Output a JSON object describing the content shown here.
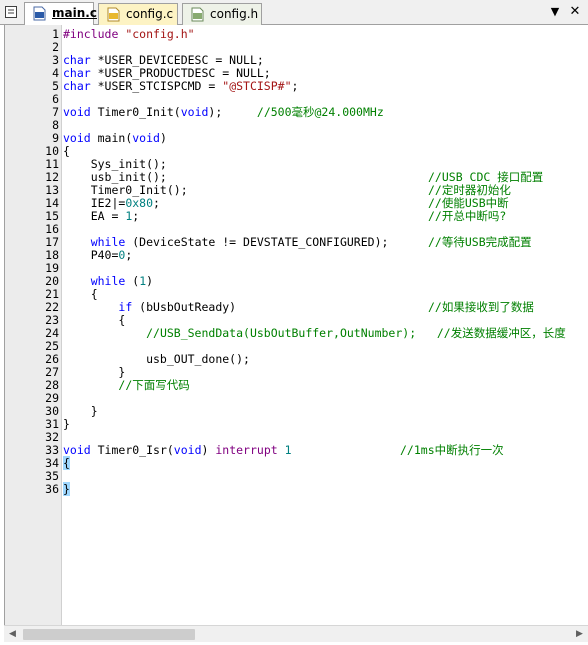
{
  "tabs": [
    {
      "label": "main.c",
      "active": true
    },
    {
      "label": "config.c",
      "active": false
    },
    {
      "label": "config.h",
      "active": false
    }
  ],
  "icons": {
    "tab_list": "document-list-icon",
    "file": "c-file-icon",
    "dropdown": "chevron-down-icon",
    "close": "close-icon",
    "scroll_left": "arrow-left-icon",
    "scroll_right": "arrow-right-icon"
  },
  "colors": {
    "keyword": "#0000ff",
    "comment": "#008000",
    "string": "#a31515",
    "number": "#008080",
    "gutter": "#ececec",
    "tab_config_c": "#fdf3c4"
  },
  "lines": [
    {
      "n": "1"
    },
    {
      "n": "2"
    },
    {
      "n": "3"
    },
    {
      "n": "4"
    },
    {
      "n": "5"
    },
    {
      "n": "6"
    },
    {
      "n": "7"
    },
    {
      "n": "8"
    },
    {
      "n": "9"
    },
    {
      "n": "10"
    },
    {
      "n": "11"
    },
    {
      "n": "12"
    },
    {
      "n": "13"
    },
    {
      "n": "14"
    },
    {
      "n": "15"
    },
    {
      "n": "16"
    },
    {
      "n": "17"
    },
    {
      "n": "18"
    },
    {
      "n": "19"
    },
    {
      "n": "20"
    },
    {
      "n": "21"
    },
    {
      "n": "22"
    },
    {
      "n": "23"
    },
    {
      "n": "24"
    },
    {
      "n": "25"
    },
    {
      "n": "26"
    },
    {
      "n": "27"
    },
    {
      "n": "28"
    },
    {
      "n": "29"
    },
    {
      "n": "30"
    },
    {
      "n": "31"
    },
    {
      "n": "32"
    },
    {
      "n": "33"
    },
    {
      "n": "34"
    },
    {
      "n": "35"
    },
    {
      "n": "36"
    }
  ],
  "code": {
    "l1_pp": "#include",
    "l1_str": "\"config.h\"",
    "l3_kw": "char",
    "l3_rest": " *USER_DEVICEDESC = NULL;",
    "l4_kw": "char",
    "l4_rest": " *USER_PRODUCTDESC = NULL;",
    "l5_kw": "char",
    "l5_rest": " *USER_STCISPCMD = ",
    "l5_str": "\"@STCISP#\"",
    "l5_end": ";",
    "l7_kw": "void",
    "l7_mid": " Timer0_Init(",
    "l7_kw2": "void",
    "l7_end": ");     ",
    "l7_cmt": "//500毫秒@24.000MHz",
    "l9_kw": "void",
    "l9_mid": " main(",
    "l9_kw2": "void",
    "l9_end": ")",
    "l10": "{",
    "l11": "    Sys_init();",
    "l12": "    usb_init();",
    "l12_cmt": "//USB CDC 接口配置",
    "l13": "    Timer0_Init();",
    "l13_cmt": "//定时器初始化",
    "l14_a": "    IE2|=",
    "l14_num": "0x80",
    "l14_b": ";",
    "l14_cmt": "//使能USB中断",
    "l15_a": "    EA = ",
    "l15_num": "1",
    "l15_b": ";",
    "l15_cmt": "//开总中断吗?",
    "l17_kw": "while",
    "l17_rest": " (DeviceState != DEVSTATE_CONFIGURED);",
    "l17_cmt": "//等待USB完成配置",
    "l18_a": "    P40=",
    "l18_num": "0",
    "l18_b": ";",
    "l20_kw": "while",
    "l20_a": " (",
    "l20_num": "1",
    "l20_b": ")",
    "l21": "    {",
    "l22_kw": "if",
    "l22_rest": " (bUsbOutReady)",
    "l22_cmt": "//如果接收到了数据",
    "l23": "        {",
    "l24_cmt": "//USB_SendData(UsbOutBuffer,OutNumber);   //发送数据缓冲区，长度",
    "l26": "            usb_OUT_done();",
    "l27": "        }",
    "l28_cmt": "//下面写代码",
    "l30": "    }",
    "l31": "}",
    "l33_kw": "void",
    "l33_mid": " Timer0_Isr(",
    "l33_kw2": "void",
    "l33_mid2": ") ",
    "l33_kw3": "interrupt",
    "l33_num": "1",
    "l33_cmt": "//1ms中断执行一次",
    "l34": "{",
    "l36": "}"
  }
}
